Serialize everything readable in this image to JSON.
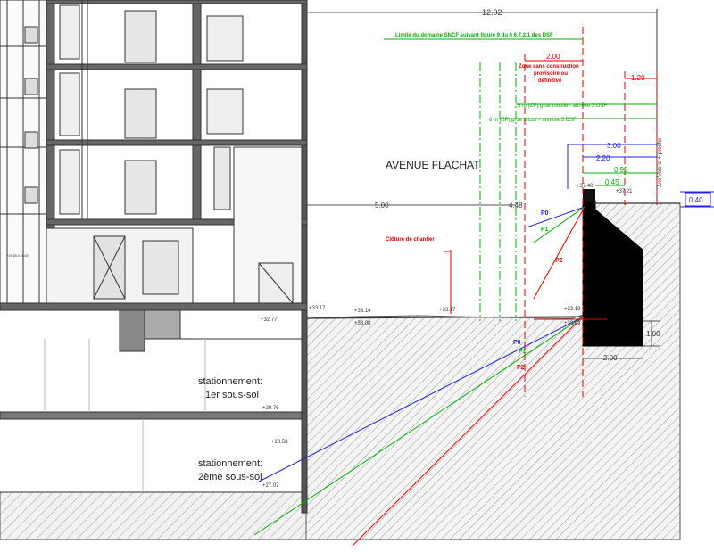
{
  "colors": {
    "green": "#00b000",
    "red": "#e00000",
    "blue": "#2020e0",
    "line": "#333333"
  },
  "dimensions": {
    "overall_width": "12.02",
    "road_width_left": "5.00",
    "road_width_right": "4.48",
    "zone_width": "2.00",
    "offset_right": "1.20",
    "wall_top_3m": "3.00",
    "wall_top_2_2": "2.20",
    "wall_top_0_95": "0.95",
    "wall_top_0_45": "0.45",
    "wall_height": "0.40",
    "footing_height": "1.00",
    "footing_width": "2.00"
  },
  "annotations": {
    "sncf_limit": "Limite du domaine SNCF suivant figure 9 du § 6.7.2.1 des DSF",
    "zone_line1": "Zone sans construction",
    "zone_line2": "provisoire ou",
    "zone_line3": "définitive",
    "crane_mobile": "5 m (ZP) grue mobile - annexe 3 DSF",
    "crane_tower": "6 m (ZP) grue à tour - annexe 3 DSF",
    "avenue": "AVENUE FLACHAT",
    "cloture": "Clôture de chantier",
    "axe_voie": "Axe Voie la + proche",
    "small_label": "+26,85 A SOUS"
  },
  "levels": {
    "l3317": "+33.17",
    "l3314": "+33.14",
    "l3308": "+33.08",
    "l3317b": "+33.17",
    "l3319": "+33.19",
    "l3303": "+33.03",
    "l3277": "+32.77",
    "l3740": "+37.40",
    "l3721": "+37.21",
    "l2976": "+29.76",
    "l2858": "+28.58",
    "l2707": "+27.07"
  },
  "zones": {
    "p0": "P0",
    "p1": "P1",
    "p2": "P2"
  },
  "parking": {
    "level1_line1": "stationnement:",
    "level1_line2": "1er sous-sol",
    "level2_line1": "stationnement:",
    "level2_line2": "2ème sous-sol"
  }
}
